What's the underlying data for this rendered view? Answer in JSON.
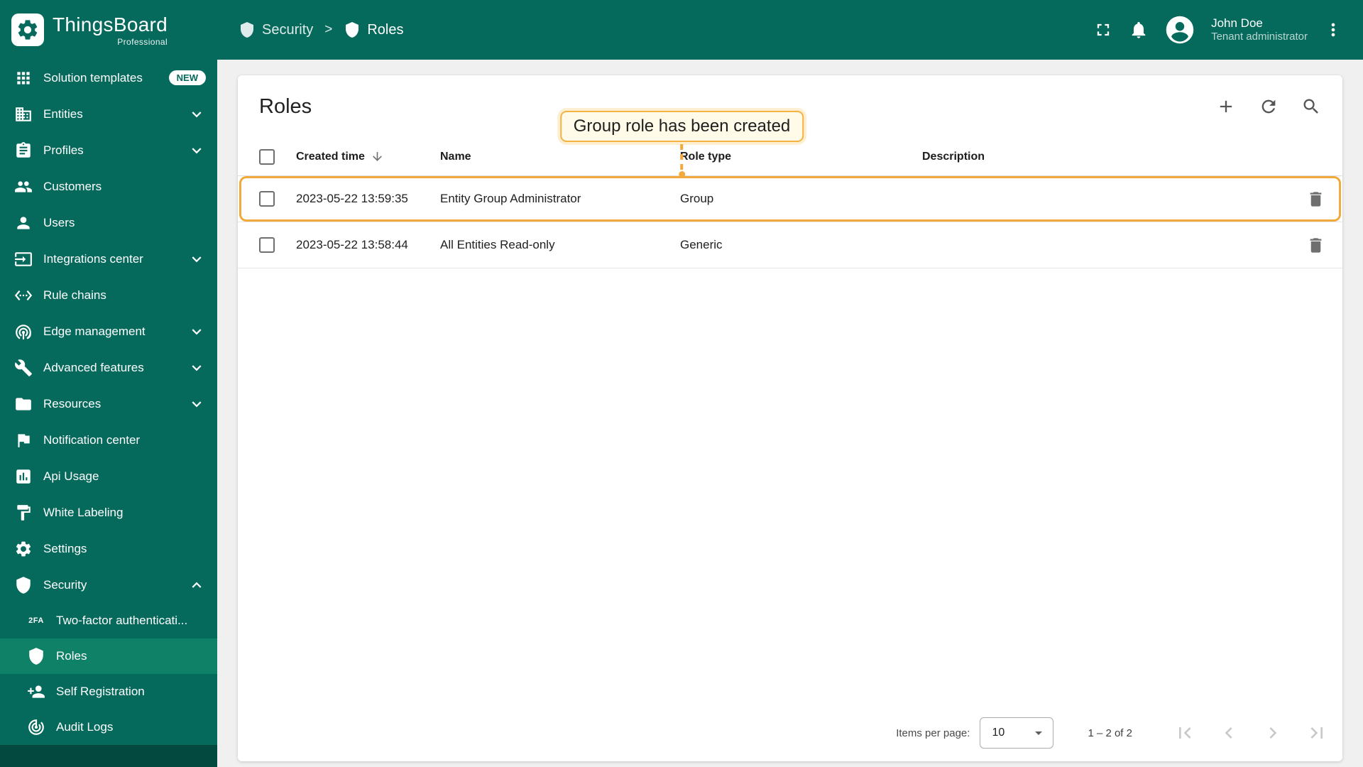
{
  "app": {
    "brand": "ThingsBoard",
    "brand_sub": "Professional"
  },
  "header": {
    "breadcrumb": [
      {
        "label": "Security"
      },
      {
        "label": "Roles"
      }
    ],
    "breadcrumb_separator": ">",
    "user": {
      "name": "John Doe",
      "role": "Tenant administrator"
    }
  },
  "sidebar": {
    "items": [
      {
        "label": "Solution templates",
        "icon": "apps",
        "badge": "NEW"
      },
      {
        "label": "Entities",
        "icon": "entities",
        "chevron": "down"
      },
      {
        "label": "Profiles",
        "icon": "profiles",
        "chevron": "down"
      },
      {
        "label": "Customers",
        "icon": "customers"
      },
      {
        "label": "Users",
        "icon": "users"
      },
      {
        "label": "Integrations center",
        "icon": "integrations",
        "chevron": "down"
      },
      {
        "label": "Rule chains",
        "icon": "rule-chains"
      },
      {
        "label": "Edge management",
        "icon": "edge",
        "chevron": "down"
      },
      {
        "label": "Advanced features",
        "icon": "advanced",
        "chevron": "down"
      },
      {
        "label": "Resources",
        "icon": "resources",
        "chevron": "down"
      },
      {
        "label": "Notification center",
        "icon": "notification"
      },
      {
        "label": "Api Usage",
        "icon": "api-usage"
      },
      {
        "label": "White Labeling",
        "icon": "white-labeling"
      },
      {
        "label": "Settings",
        "icon": "settings"
      },
      {
        "label": "Security",
        "icon": "security",
        "chevron": "up",
        "expanded": true,
        "children": [
          {
            "label": "Two-factor authenticati...",
            "icon": "two-factor"
          },
          {
            "label": "Roles",
            "icon": "roles",
            "active": true
          },
          {
            "label": "Self Registration",
            "icon": "self-registration"
          },
          {
            "label": "Audit Logs",
            "icon": "audit-logs"
          }
        ]
      }
    ]
  },
  "main": {
    "title": "Roles",
    "callout_text": "Group role has been created",
    "table": {
      "columns": [
        "Created time",
        "Name",
        "Role type",
        "Description"
      ],
      "rows": [
        {
          "created_time": "2023-05-22 13:59:35",
          "name": "Entity Group Administrator",
          "role_type": "Group",
          "description": "",
          "highlighted": true
        },
        {
          "created_time": "2023-05-22 13:58:44",
          "name": "All Entities Read-only",
          "role_type": "Generic",
          "description": "",
          "highlighted": false
        }
      ]
    },
    "pagination": {
      "items_per_page_label": "Items per page:",
      "items_per_page_value": "10",
      "range": "1 – 2 of 2"
    }
  },
  "colors": {
    "sidebar_bg": "#05695c",
    "sidebar_active": "#0f8167",
    "highlight_orange": "#f2a93c",
    "callout_bg": "#fffbe8",
    "content_bg": "#f0f0f0"
  }
}
